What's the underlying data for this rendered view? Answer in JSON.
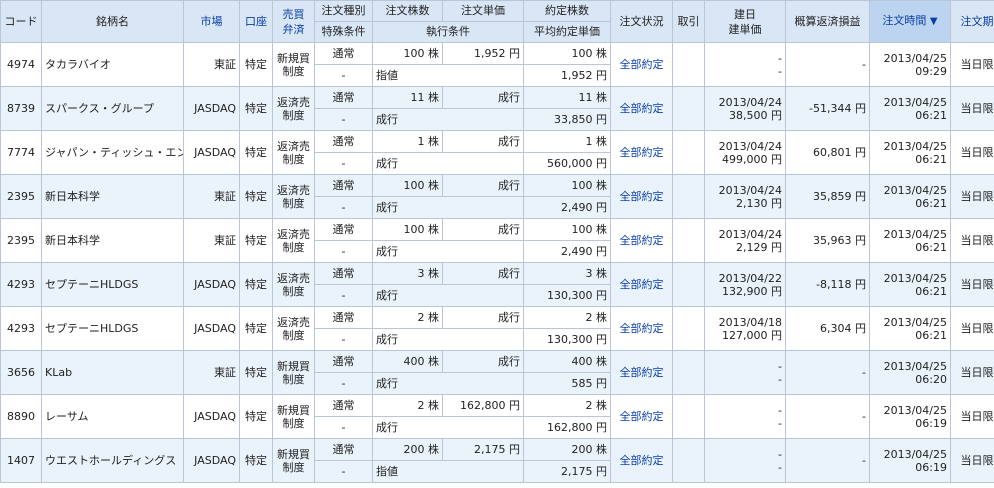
{
  "headers": {
    "code": "コード",
    "name": "銘柄名",
    "market": "市場",
    "account": "口座",
    "side_line1": "売買",
    "side_line2": "弁済",
    "order_type": "注文種別",
    "special": "特殊条件",
    "qty": "注文株数",
    "price": "注文単価",
    "exec_cond": "執行条件",
    "filled_qty": "約定株数",
    "avg_price": "平均約定単価",
    "status": "注文状況",
    "cancel": "取引",
    "open_line1": "建日",
    "open_line2": "建単価",
    "pnl": "概算返済損益",
    "order_time": "注文時間",
    "sort_arrow": "▼",
    "expiry": "注文期限"
  },
  "rows": [
    {
      "code": "4974",
      "name": "タカラバイオ",
      "market": "東証",
      "account": "特定",
      "side1": "新規買",
      "side2": "制度",
      "order_type": "通常",
      "special": "-",
      "qty": "100 株",
      "price": "1,952 円",
      "exec_cond": "指値",
      "filled_qty": "100 株",
      "avg_price": "1,952 円",
      "status": "全部約定",
      "open_date": "-",
      "open_price": "-",
      "pnl": "-",
      "time1": "2013/04/25",
      "time2": "09:29",
      "expiry": "当日限り"
    },
    {
      "code": "8739",
      "name": "スパークス・グループ",
      "market": "JASDAQ",
      "account": "特定",
      "side1": "返済売",
      "side2": "制度",
      "order_type": "通常",
      "special": "-",
      "qty": "11 株",
      "price": "成行",
      "exec_cond": "成行",
      "filled_qty": "11 株",
      "avg_price": "33,850 円",
      "status": "全部約定",
      "open_date": "2013/04/24",
      "open_price": "38,500 円",
      "pnl": "-51,344 円",
      "time1": "2013/04/25",
      "time2": "06:21",
      "expiry": "当日限り"
    },
    {
      "code": "7774",
      "name": "ジャパン・ティッシュ・エンジ",
      "market": "JASDAQ",
      "account": "特定",
      "side1": "返済売",
      "side2": "制度",
      "order_type": "通常",
      "special": "-",
      "qty": "1 株",
      "price": "成行",
      "exec_cond": "成行",
      "filled_qty": "1 株",
      "avg_price": "560,000 円",
      "status": "全部約定",
      "open_date": "2013/04/24",
      "open_price": "499,000 円",
      "pnl": "60,801 円",
      "time1": "2013/04/25",
      "time2": "06:21",
      "expiry": "当日限り"
    },
    {
      "code": "2395",
      "name": "新日本科学",
      "market": "東証",
      "account": "特定",
      "side1": "返済売",
      "side2": "制度",
      "order_type": "通常",
      "special": "-",
      "qty": "100 株",
      "price": "成行",
      "exec_cond": "成行",
      "filled_qty": "100 株",
      "avg_price": "2,490 円",
      "status": "全部約定",
      "open_date": "2013/04/24",
      "open_price": "2,130 円",
      "pnl": "35,859 円",
      "time1": "2013/04/25",
      "time2": "06:21",
      "expiry": "当日限り"
    },
    {
      "code": "2395",
      "name": "新日本科学",
      "market": "東証",
      "account": "特定",
      "side1": "返済売",
      "side2": "制度",
      "order_type": "通常",
      "special": "-",
      "qty": "100 株",
      "price": "成行",
      "exec_cond": "成行",
      "filled_qty": "100 株",
      "avg_price": "2,490 円",
      "status": "全部約定",
      "open_date": "2013/04/24",
      "open_price": "2,129 円",
      "pnl": "35,963 円",
      "time1": "2013/04/25",
      "time2": "06:21",
      "expiry": "当日限り"
    },
    {
      "code": "4293",
      "name": "セプテーニHLDGS",
      "market": "JASDAQ",
      "account": "特定",
      "side1": "返済売",
      "side2": "制度",
      "order_type": "通常",
      "special": "-",
      "qty": "3 株",
      "price": "成行",
      "exec_cond": "成行",
      "filled_qty": "3 株",
      "avg_price": "130,300 円",
      "status": "全部約定",
      "open_date": "2013/04/22",
      "open_price": "132,900 円",
      "pnl": "-8,118 円",
      "time1": "2013/04/25",
      "time2": "06:21",
      "expiry": "当日限り"
    },
    {
      "code": "4293",
      "name": "セプテーニHLDGS",
      "market": "JASDAQ",
      "account": "特定",
      "side1": "返済売",
      "side2": "制度",
      "order_type": "通常",
      "special": "-",
      "qty": "2 株",
      "price": "成行",
      "exec_cond": "成行",
      "filled_qty": "2 株",
      "avg_price": "130,300 円",
      "status": "全部約定",
      "open_date": "2013/04/18",
      "open_price": "127,000 円",
      "pnl": "6,304 円",
      "time1": "2013/04/25",
      "time2": "06:21",
      "expiry": "当日限り"
    },
    {
      "code": "3656",
      "name": "KLab",
      "market": "東証",
      "account": "特定",
      "side1": "新規買",
      "side2": "制度",
      "order_type": "通常",
      "special": "-",
      "qty": "400 株",
      "price": "成行",
      "exec_cond": "成行",
      "filled_qty": "400 株",
      "avg_price": "585 円",
      "status": "全部約定",
      "open_date": "-",
      "open_price": "-",
      "pnl": "-",
      "time1": "2013/04/25",
      "time2": "06:20",
      "expiry": "当日限り"
    },
    {
      "code": "8890",
      "name": "レーサム",
      "market": "JASDAQ",
      "account": "特定",
      "side1": "新規買",
      "side2": "制度",
      "order_type": "通常",
      "special": "-",
      "qty": "2 株",
      "price": "162,800 円",
      "exec_cond": "成行",
      "filled_qty": "2 株",
      "avg_price": "162,800 円",
      "status": "全部約定",
      "open_date": "-",
      "open_price": "-",
      "pnl": "-",
      "time1": "2013/04/25",
      "time2": "06:19",
      "expiry": "当日限り"
    },
    {
      "code": "1407",
      "name": "ウエストホールディングス",
      "market": "JASDAQ",
      "account": "特定",
      "side1": "新規買",
      "side2": "制度",
      "order_type": "通常",
      "special": "-",
      "qty": "200 株",
      "price": "2,175 円",
      "exec_cond": "指値",
      "filled_qty": "200 株",
      "avg_price": "2,175 円",
      "status": "全部約定",
      "open_date": "-",
      "open_price": "-",
      "pnl": "-",
      "time1": "2013/04/25",
      "time2": "06:19",
      "expiry": "当日限り"
    }
  ]
}
